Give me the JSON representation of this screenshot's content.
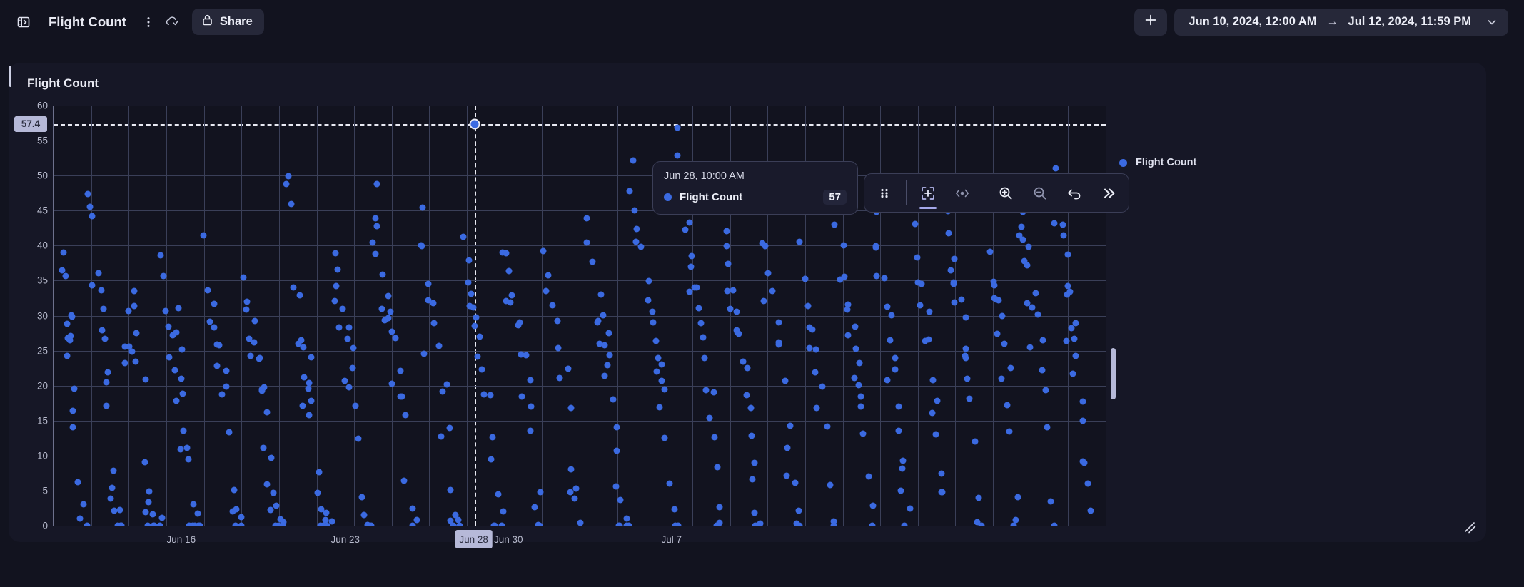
{
  "topbar": {
    "panel_toggle_icon": "panel-toggle-icon",
    "title": "Flight Count",
    "more_icon": "kebab-menu-icon",
    "cloud_icon": "cloud-check-icon",
    "share": {
      "label": "Share",
      "icon": "lock-icon"
    },
    "add": {
      "label": "+",
      "icon": "plus-icon"
    },
    "date_range": {
      "start": "Jun 10, 2024, 12:00 AM",
      "separator": "→",
      "end": "Jul 12, 2024, 11:59 PM",
      "chevron_icon": "chevron-down-icon"
    }
  },
  "card": {
    "title": "Flight Count",
    "resize_icon": "resize-handle-icon"
  },
  "tooltip": {
    "time": "Jun 28, 10:00 AM",
    "series_name": "Flight Count",
    "value": "57",
    "dot_color": "#3b6ae1"
  },
  "chart_toolbar": {
    "items": [
      {
        "name": "drag-handle-icon",
        "label": "",
        "active": false
      },
      {
        "name": "box-select-icon",
        "label": "",
        "active": true
      },
      {
        "name": "compare-icon",
        "label": "",
        "active": false
      },
      {
        "name": "zoom-in-icon",
        "label": "",
        "active": false
      },
      {
        "name": "zoom-out-icon",
        "label": "",
        "active": false
      },
      {
        "name": "undo-icon",
        "label": "",
        "active": false
      },
      {
        "name": "collapse-right-icon",
        "label": "",
        "active": false
      }
    ]
  },
  "legend": {
    "items": [
      {
        "label": "Flight Count",
        "color": "#3b6ae1"
      }
    ]
  },
  "crosshair": {
    "y_label": "57.4",
    "x_label": "Jun 28"
  },
  "colors": {
    "accent": "#3b6ae1",
    "page_bg": "#12131f",
    "card_bg": "#161726",
    "grid": "#3a3f58",
    "axis": "#6d718c",
    "highlight": "#b6b9d8",
    "text": "#e9eaf3"
  },
  "chart_data": {
    "type": "scatter",
    "title": "Flight Count",
    "xlabel": "",
    "ylabel": "",
    "ylim": [
      0,
      60
    ],
    "yticks": [
      0,
      5,
      10,
      15,
      20,
      25,
      30,
      35,
      40,
      45,
      50,
      55,
      60
    ],
    "xtick_labels": [
      "Jun 16",
      "Jun 23",
      "Jun 28",
      "Jun 30",
      "Jul 7"
    ],
    "xtick_positions": [
      0.122,
      0.278,
      0.4,
      0.433,
      0.588
    ],
    "x_range": [
      "Jun 10, 2024, 12:00 AM",
      "Jul 12, 2024, 11:59 PM"
    ],
    "grid": true,
    "legend_position": "right",
    "series": [
      {
        "name": "Flight Count",
        "color": "#3b6ae1",
        "highlighted_point": {
          "x": "Jun 28, 10:00 AM",
          "y": 57
        },
        "points": [
          [
            2,
            36
          ],
          [
            3,
            38
          ],
          [
            4,
            30
          ],
          [
            4,
            31
          ],
          [
            5,
            26
          ],
          [
            5,
            19
          ],
          [
            6,
            7
          ],
          [
            7,
            2
          ],
          [
            8,
            2
          ],
          [
            9,
            47
          ],
          [
            10,
            34
          ],
          [
            11,
            36
          ],
          [
            12,
            33
          ],
          [
            13,
            26
          ],
          [
            13,
            17
          ],
          [
            14,
            4
          ],
          [
            15,
            8
          ],
          [
            16,
            1
          ],
          [
            17,
            2
          ],
          [
            18,
            26
          ],
          [
            19,
            31
          ],
          [
            20,
            34
          ],
          [
            21,
            27
          ],
          [
            22,
            20
          ],
          [
            23,
            9
          ],
          [
            24,
            3
          ],
          [
            25,
            1
          ],
          [
            26,
            1
          ],
          [
            27,
            38
          ],
          [
            28,
            30
          ],
          [
            29,
            28
          ],
          [
            30,
            31
          ],
          [
            31,
            25
          ],
          [
            32,
            18
          ],
          [
            33,
            11
          ],
          [
            34,
            2
          ],
          [
            35,
            2
          ],
          [
            36,
            1
          ],
          [
            37,
            41
          ],
          [
            38,
            33
          ],
          [
            39,
            31
          ],
          [
            40,
            28
          ],
          [
            41,
            26
          ],
          [
            42,
            22
          ],
          [
            43,
            14
          ],
          [
            44,
            6
          ],
          [
            45,
            2
          ],
          [
            46,
            1
          ],
          [
            47,
            35
          ],
          [
            48,
            31
          ],
          [
            49,
            29
          ],
          [
            50,
            27
          ],
          [
            51,
            24
          ],
          [
            52,
            19
          ],
          [
            53,
            10
          ],
          [
            54,
            4
          ],
          [
            55,
            2
          ],
          [
            56,
            1
          ],
          [
            57,
            1
          ],
          [
            58,
            50
          ],
          [
            59,
            34
          ],
          [
            60,
            32
          ],
          [
            61,
            27
          ],
          [
            62,
            25
          ],
          [
            63,
            23
          ],
          [
            64,
            17
          ],
          [
            65,
            8
          ],
          [
            66,
            3
          ],
          [
            67,
            2
          ],
          [
            68,
            1
          ],
          [
            69,
            38
          ],
          [
            70,
            36
          ],
          [
            71,
            31
          ],
          [
            72,
            29
          ],
          [
            73,
            26
          ],
          [
            74,
            18
          ],
          [
            75,
            12
          ],
          [
            76,
            5
          ],
          [
            77,
            2
          ],
          [
            78,
            1
          ],
          [
            79,
            48
          ],
          [
            80,
            43
          ],
          [
            81,
            35
          ],
          [
            82,
            33
          ],
          [
            83,
            30
          ],
          [
            84,
            26
          ],
          [
            85,
            22
          ],
          [
            86,
            15
          ],
          [
            87,
            7
          ],
          [
            88,
            2
          ],
          [
            89,
            1
          ],
          [
            90,
            45
          ],
          [
            91,
            40
          ],
          [
            92,
            35
          ],
          [
            93,
            31
          ],
          [
            94,
            28
          ],
          [
            95,
            25
          ],
          [
            96,
            21
          ],
          [
            97,
            15
          ],
          [
            98,
            6
          ],
          [
            99,
            2
          ],
          [
            100,
            1
          ],
          [
            101,
            42
          ],
          [
            102,
            38
          ],
          [
            103,
            34
          ],
          [
            104,
            30
          ],
          [
            105,
            27
          ],
          [
            106,
            23
          ],
          [
            107,
            19
          ],
          [
            108,
            12
          ],
          [
            109,
            4
          ],
          [
            110,
            2
          ],
          [
            111,
            40
          ],
          [
            112,
            36
          ],
          [
            113,
            33
          ],
          [
            114,
            30
          ],
          [
            115,
            28
          ],
          [
            116,
            24
          ],
          [
            117,
            20
          ],
          [
            118,
            13
          ],
          [
            119,
            5
          ],
          [
            120,
            1
          ],
          [
            121,
            39
          ],
          [
            122,
            35
          ],
          [
            123,
            32
          ],
          [
            124,
            29
          ],
          [
            125,
            26
          ],
          [
            126,
            22
          ],
          [
            127,
            17
          ],
          [
            128,
            9
          ],
          [
            129,
            3
          ],
          [
            130,
            1
          ],
          [
            131,
            44
          ],
          [
            132,
            41
          ],
          [
            133,
            37
          ],
          [
            134,
            33
          ],
          [
            135,
            30
          ],
          [
            136,
            27
          ],
          [
            137,
            24
          ],
          [
            138,
            18
          ],
          [
            139,
            10
          ],
          [
            140,
            3
          ],
          [
            141,
            1
          ],
          [
            142,
            53
          ],
          [
            143,
            46
          ],
          [
            144,
            43
          ],
          [
            145,
            40
          ],
          [
            146,
            36
          ],
          [
            147,
            33
          ],
          [
            148,
            29
          ],
          [
            149,
            25
          ],
          [
            150,
            20
          ],
          [
            151,
            13
          ],
          [
            152,
            5
          ],
          [
            153,
            2
          ],
          [
            154,
            57
          ],
          [
            155,
            51
          ],
          [
            156,
            44
          ],
          [
            157,
            39
          ],
          [
            158,
            35
          ],
          [
            159,
            32
          ],
          [
            160,
            28
          ],
          [
            161,
            24
          ],
          [
            162,
            18
          ],
          [
            163,
            9
          ],
          [
            164,
            2
          ],
          [
            165,
            42
          ],
          [
            166,
            38
          ],
          [
            167,
            34
          ],
          [
            168,
            31
          ],
          [
            169,
            27
          ],
          [
            170,
            23
          ],
          [
            171,
            17
          ],
          [
            172,
            8
          ],
          [
            173,
            2
          ],
          [
            174,
            1
          ],
          [
            175,
            41
          ],
          [
            176,
            37
          ],
          [
            177,
            33
          ],
          [
            178,
            30
          ],
          [
            179,
            26
          ],
          [
            180,
            21
          ],
          [
            181,
            15
          ],
          [
            182,
            7
          ],
          [
            183,
            2
          ],
          [
            184,
            40
          ],
          [
            185,
            36
          ],
          [
            186,
            32
          ],
          [
            187,
            29
          ],
          [
            188,
            25
          ],
          [
            189,
            20
          ],
          [
            190,
            14
          ],
          [
            191,
            6
          ],
          [
            192,
            1
          ],
          [
            193,
            43
          ],
          [
            194,
            39
          ],
          [
            195,
            35
          ],
          [
            196,
            31
          ],
          [
            197,
            28
          ],
          [
            198,
            23
          ],
          [
            199,
            16
          ],
          [
            200,
            8
          ],
          [
            201,
            2
          ],
          [
            202,
            44
          ],
          [
            203,
            40
          ],
          [
            204,
            36
          ],
          [
            205,
            32
          ],
          [
            206,
            29
          ],
          [
            207,
            24
          ],
          [
            208,
            18
          ],
          [
            209,
            10
          ],
          [
            210,
            3
          ],
          [
            211,
            47
          ],
          [
            212,
            42
          ],
          [
            213,
            38
          ],
          [
            214,
            34
          ],
          [
            215,
            30
          ],
          [
            216,
            26
          ],
          [
            217,
            21
          ],
          [
            218,
            12
          ],
          [
            219,
            4
          ],
          [
            220,
            45
          ],
          [
            221,
            41
          ],
          [
            222,
            37
          ],
          [
            223,
            33
          ],
          [
            224,
            29
          ],
          [
            225,
            25
          ],
          [
            226,
            19
          ],
          [
            227,
            11
          ],
          [
            228,
            3
          ],
          [
            229,
            50
          ],
          [
            230,
            46
          ],
          [
            231,
            40
          ],
          [
            232,
            35
          ],
          [
            233,
            31
          ],
          [
            234,
            27
          ],
          [
            235,
            22
          ],
          [
            236,
            14
          ],
          [
            237,
            5
          ],
          [
            238,
            48
          ],
          [
            239,
            43
          ],
          [
            240,
            39
          ],
          [
            241,
            34
          ],
          [
            242,
            30
          ],
          [
            243,
            26
          ],
          [
            244,
            20
          ],
          [
            245,
            13
          ],
          [
            246,
            4
          ],
          [
            247,
            51
          ],
          [
            248,
            44
          ],
          [
            249,
            38
          ],
          [
            250,
            33
          ],
          [
            251,
            29
          ],
          [
            252,
            24
          ],
          [
            253,
            18
          ],
          [
            254,
            9
          ],
          [
            255,
            2
          ]
        ]
      }
    ]
  }
}
